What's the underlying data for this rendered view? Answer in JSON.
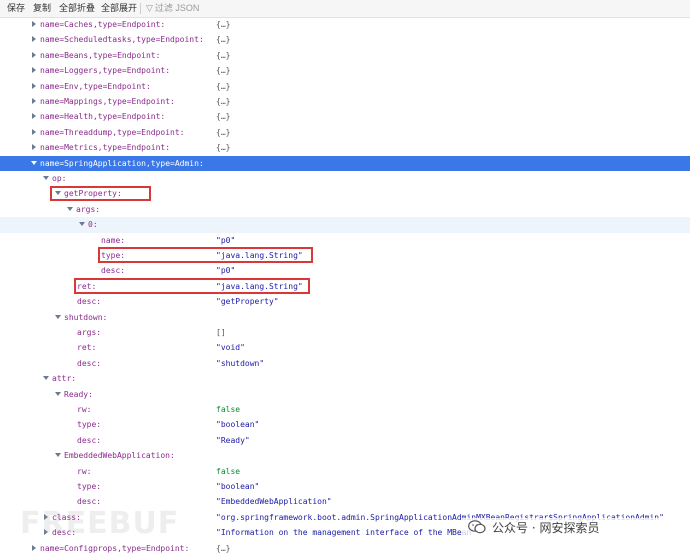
{
  "toolbar": {
    "save": "保存",
    "copy": "复制",
    "collapse_all": "全部折叠",
    "expand_all": "全部展开",
    "filter_placeholder": "过滤 JSON"
  },
  "tree": {
    "collapsed_marker": "{…}",
    "nodes": [
      {
        "key": "name=Caches,type=Endpoint:",
        "value": "{…}"
      },
      {
        "key": "name=Scheduledtasks,type=Endpoint:",
        "value": "{…}"
      },
      {
        "key": "name=Beans,type=Endpoint:",
        "value": "{…}"
      },
      {
        "key": "name=Loggers,type=Endpoint:",
        "value": "{…}"
      },
      {
        "key": "name=Env,type=Endpoint:",
        "value": "{…}"
      },
      {
        "key": "name=Mappings,type=Endpoint:",
        "value": "{…}"
      },
      {
        "key": "name=Health,type=Endpoint:",
        "value": "{…}"
      },
      {
        "key": "name=Threaddump,type=Endpoint:",
        "value": "{…}"
      },
      {
        "key": "name=Metrics,type=Endpoint:",
        "value": "{…}"
      },
      {
        "key": "name=SpringApplication,type=Admin:",
        "value": ""
      },
      {
        "key": "op:",
        "value": ""
      },
      {
        "key": "getProperty:",
        "value": ""
      },
      {
        "key": "args:",
        "value": ""
      },
      {
        "key": "0:",
        "value": ""
      },
      {
        "key": "name:",
        "value": "\"p0\""
      },
      {
        "key": "type:",
        "value": "\"java.lang.String\""
      },
      {
        "key": "desc:",
        "value": "\"p0\""
      },
      {
        "key": "ret:",
        "value": "\"java.lang.String\""
      },
      {
        "key": "desc:",
        "value": "\"getProperty\""
      },
      {
        "key": "shutdown:",
        "value": ""
      },
      {
        "key": "args:",
        "value": "[]"
      },
      {
        "key": "ret:",
        "value": "\"void\""
      },
      {
        "key": "desc:",
        "value": "\"shutdown\""
      },
      {
        "key": "attr:",
        "value": ""
      },
      {
        "key": "Ready:",
        "value": ""
      },
      {
        "key": "rw:",
        "value": "false"
      },
      {
        "key": "type:",
        "value": "\"boolean\""
      },
      {
        "key": "desc:",
        "value": "\"Ready\""
      },
      {
        "key": "EmbeddedWebApplication:",
        "value": ""
      },
      {
        "key": "rw:",
        "value": "false"
      },
      {
        "key": "type:",
        "value": "\"boolean\""
      },
      {
        "key": "desc:",
        "value": "\"EmbeddedWebApplication\""
      },
      {
        "key": "class:",
        "value": "\"org.springframework.boot.admin.SpringApplicationAdminMXBeanRegistrar$SpringApplicationAdmin\""
      },
      {
        "key": "desc:",
        "value": "\"Information on the management interface of the MBean\""
      },
      {
        "key": "name=Configprops,type=Endpoint:",
        "value": "{…}"
      }
    ]
  },
  "watermarks": {
    "left": "FREEBUF",
    "right": "公众号 · 网安探索员",
    "right_icon": "wechat-icon"
  },
  "colors": {
    "selected_row": "#3b78e7",
    "key": "#8b2a8b",
    "string": "#1a1aa6",
    "boolean": "#0b8a2f",
    "highlight_box": "#d9383a"
  }
}
